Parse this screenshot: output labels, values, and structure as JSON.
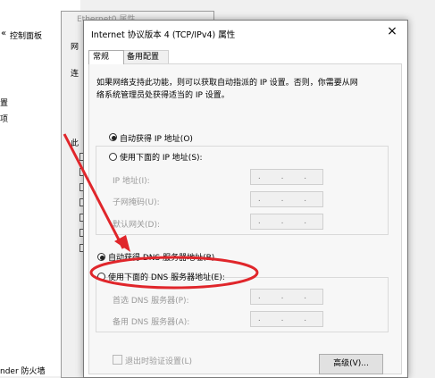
{
  "background": {
    "control_panel_label": "控制面板",
    "side_texts": [
      "置",
      "项",
      "nder 防火墙"
    ],
    "ethernet_title": "Ethernet0 属性",
    "ethernet_labels": [
      "网",
      "连",
      "此"
    ]
  },
  "dialog": {
    "title": "Internet 协议版本 4 (TCP/IPv4) 属性",
    "close_glyph": "×",
    "tabs": [
      {
        "label": "常规",
        "active": true
      },
      {
        "label": "备用配置",
        "active": false
      }
    ],
    "description_line1": "如果网络支持此功能，则可以获取自动指派的 IP 设置。否则，你需要从网",
    "description_line2": "络系统管理员处获得适当的 IP 设置。",
    "ip_auto": "自动获得 IP 地址(O)",
    "ip_manual": "使用下面的 IP 地址(S):",
    "ip_address_label": "IP 地址(I):",
    "subnet_label": "子网掩码(U):",
    "gateway_label": "默认网关(D):",
    "ip_placeholder": ". . .",
    "dns_auto": "自动获得 DNS 服务器地址(B)",
    "dns_manual": "使用下面的 DNS 服务器地址(E):",
    "dns_preferred_label": "首选 DNS 服务器(P):",
    "dns_alternate_label": "备用 DNS 服务器(A):",
    "validate_label": "退出时验证设置(L)",
    "advanced_button": "高级(V)..."
  },
  "annotation_color": "#e0262b"
}
